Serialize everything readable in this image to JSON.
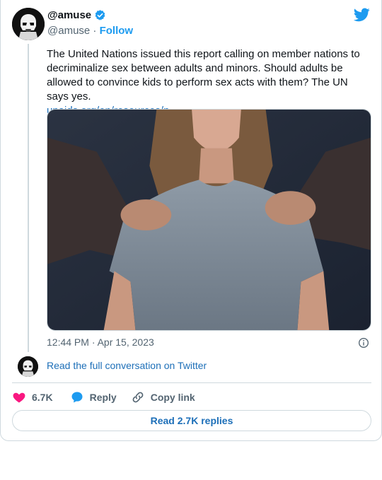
{
  "author": {
    "display_name": "@amuse",
    "handle": "@amuse",
    "separator": "·",
    "follow_label": "Follow"
  },
  "tweet": {
    "text": "The United Nations issued this report calling on member nations to decriminalize sex between adults and minors. Should adults be allowed to convince kids to perform sex acts with them? The UN says yes.",
    "link_text": "unaids.org/en/resources/p…",
    "timestamp": "12:44 PM · Apr 15, 2023"
  },
  "conversation": {
    "read_full_label": "Read the full conversation on Twitter"
  },
  "actions": {
    "like_count": "6.7K",
    "reply_label": "Reply",
    "copy_link_label": "Copy link"
  },
  "footer": {
    "read_replies_label": "Read 2.7K replies"
  },
  "colors": {
    "accent": "#1d9bf0",
    "link": "#1d6fb8",
    "like": "#f91880",
    "muted": "#536471",
    "border": "#cfd9de"
  },
  "icons": [
    "verified-badge-icon",
    "twitter-bird-icon",
    "info-icon",
    "heart-icon",
    "reply-bubble-icon",
    "copy-link-icon"
  ]
}
